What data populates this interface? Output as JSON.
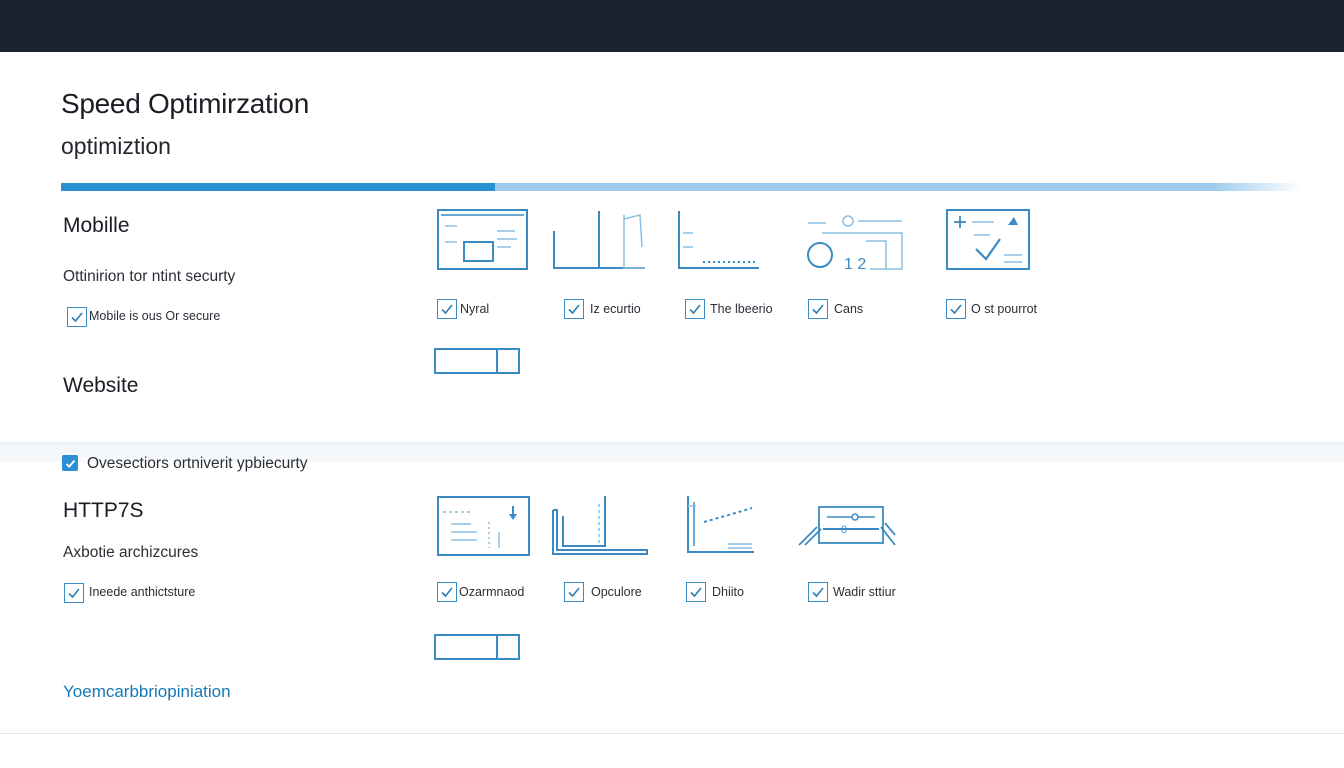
{
  "header": {
    "title": "Speed Optimirzation",
    "subtitle": "optimiztion",
    "progress_fraction": 0.35
  },
  "section1": {
    "heading1": "Mobille",
    "description": "Ottinirion tor ntint securty",
    "checkbox_label": "Mobile is ous Or secure",
    "heading2": "Website",
    "options": [
      {
        "label": "Nyral",
        "icon": "layout-window-icon"
      },
      {
        "label": "Iz ecurtio",
        "icon": "bar-pillar-icon"
      },
      {
        "label": "The lbeerio",
        "icon": "baseline-chart-icon"
      },
      {
        "label": "Cans",
        "icon": "dial-grid-icon"
      },
      {
        "label": "O st pourrot",
        "icon": "check-window-icon"
      }
    ]
  },
  "band": {
    "checkbox_label": "Ovesectiors ortniverit ypbiecurty"
  },
  "section2": {
    "heading1": "HTTP7S",
    "description": "Axbotie archizcures",
    "checkbox_label": "Ineede anthictsture",
    "options": [
      {
        "label": "Ozarmnaod",
        "icon": "window-arrow-icon"
      },
      {
        "label": "Opculore",
        "icon": "pillar-frame-icon"
      },
      {
        "label": "Dhiito",
        "icon": "trend-chart-icon"
      },
      {
        "label": "Wadir sttiur",
        "icon": "slider-card-icon"
      }
    ],
    "footer_link": "Yoemcarbbriopiniation"
  },
  "colors": {
    "accent": "#2b8fd3",
    "accent_light": "#9fccef",
    "line": "#3a8bc3",
    "topbar": "#1c2231",
    "link": "#1479b8"
  }
}
